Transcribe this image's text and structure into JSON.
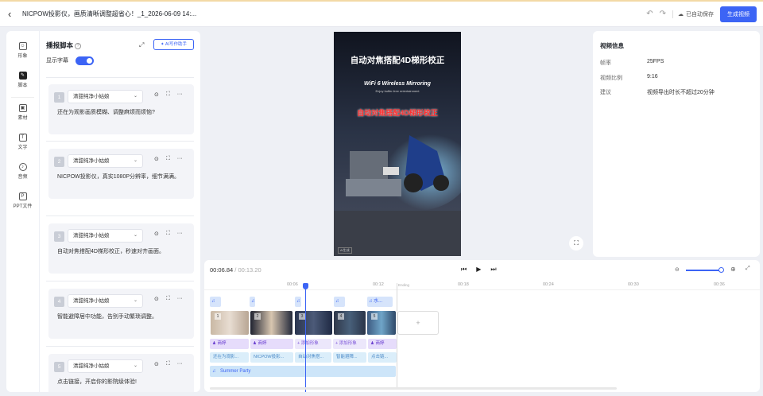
{
  "header": {
    "back_icon": "chevron-left-icon",
    "title": "NICPOW投影仪，画质清晰调整超省心！_1_2026-06-09 14:...",
    "undo_icon": "undo-icon",
    "redo_icon": "redo-icon",
    "autosave_label": "已自动保存",
    "generate_button": "生成视频"
  },
  "rail": {
    "items": [
      {
        "label": "形象",
        "icon": "person-icon"
      },
      {
        "label": "脚本",
        "icon": "script-icon",
        "active": true
      },
      {
        "label": "素材",
        "icon": "media-icon"
      },
      {
        "label": "文字",
        "icon": "text-icon"
      },
      {
        "label": "音频",
        "icon": "audio-icon"
      },
      {
        "label": "PPT文件",
        "icon": "ppt-icon"
      }
    ]
  },
  "script_panel": {
    "title": "播报脚本",
    "help_icon": "?",
    "ai_button": "AI写作助手",
    "subtitle_label": "显示字幕",
    "subtitle_on": true,
    "cards": [
      {
        "num": "1",
        "voice": "清甜纯净小姑娘",
        "text": "还在为观影画质模糊、调整麻烦而烦恼?"
      },
      {
        "num": "2",
        "voice": "清甜纯净小姑娘",
        "text": "NICPOW投影仪，真实1080P分辨率，细节满满。"
      },
      {
        "num": "3",
        "voice": "清甜纯净小姑娘",
        "text": "自动对焦搭配4D梯形校正，秒速对齐画面。"
      },
      {
        "num": "4",
        "voice": "清甜纯净小姑娘",
        "text": "智能避障居中功能，告别手动繁琐调整。"
      },
      {
        "num": "5",
        "voice": "清甜纯净小姑娘",
        "text": "点击链接，开启你的影院级体验!"
      }
    ]
  },
  "video": {
    "title": "自动对焦搭配4D梯形校正",
    "wifi": "WiFi 6 Wireless Mirroring",
    "sub": "Enjoy buffer-free entertainment",
    "red_caption": "自动对焦搭配4D梯形校正",
    "logo": "AI生成"
  },
  "video_info": {
    "title": "视频信息",
    "rows": [
      {
        "label": "帧率",
        "value": "25FPS"
      },
      {
        "label": "视频比例",
        "value": "9:16"
      },
      {
        "label": "建议",
        "value": "视频导出时长不超过20分钟"
      }
    ]
  },
  "timeline": {
    "current": "00:06.84",
    "total": "/ 00:13.20",
    "ticks": [
      "00:06",
      "00:12",
      "00:18",
      "00:24",
      "00:30",
      "00:36"
    ],
    "ending": "Ending",
    "music_label": "水...",
    "avatars": [
      "商婷",
      "商婷",
      "添加形象",
      "添加形象",
      "商婷"
    ],
    "subtitles": [
      "还在为观影...",
      "NICPOW投影...",
      "自动对焦搭...",
      "智能避障...",
      "点击链..."
    ],
    "bgm": "Summer Party",
    "playhead_time": "00:06.84"
  },
  "colors": {
    "accent": "#3c64f5",
    "avatar": "#e6dcfb",
    "subtitle": "#dbeefa"
  }
}
